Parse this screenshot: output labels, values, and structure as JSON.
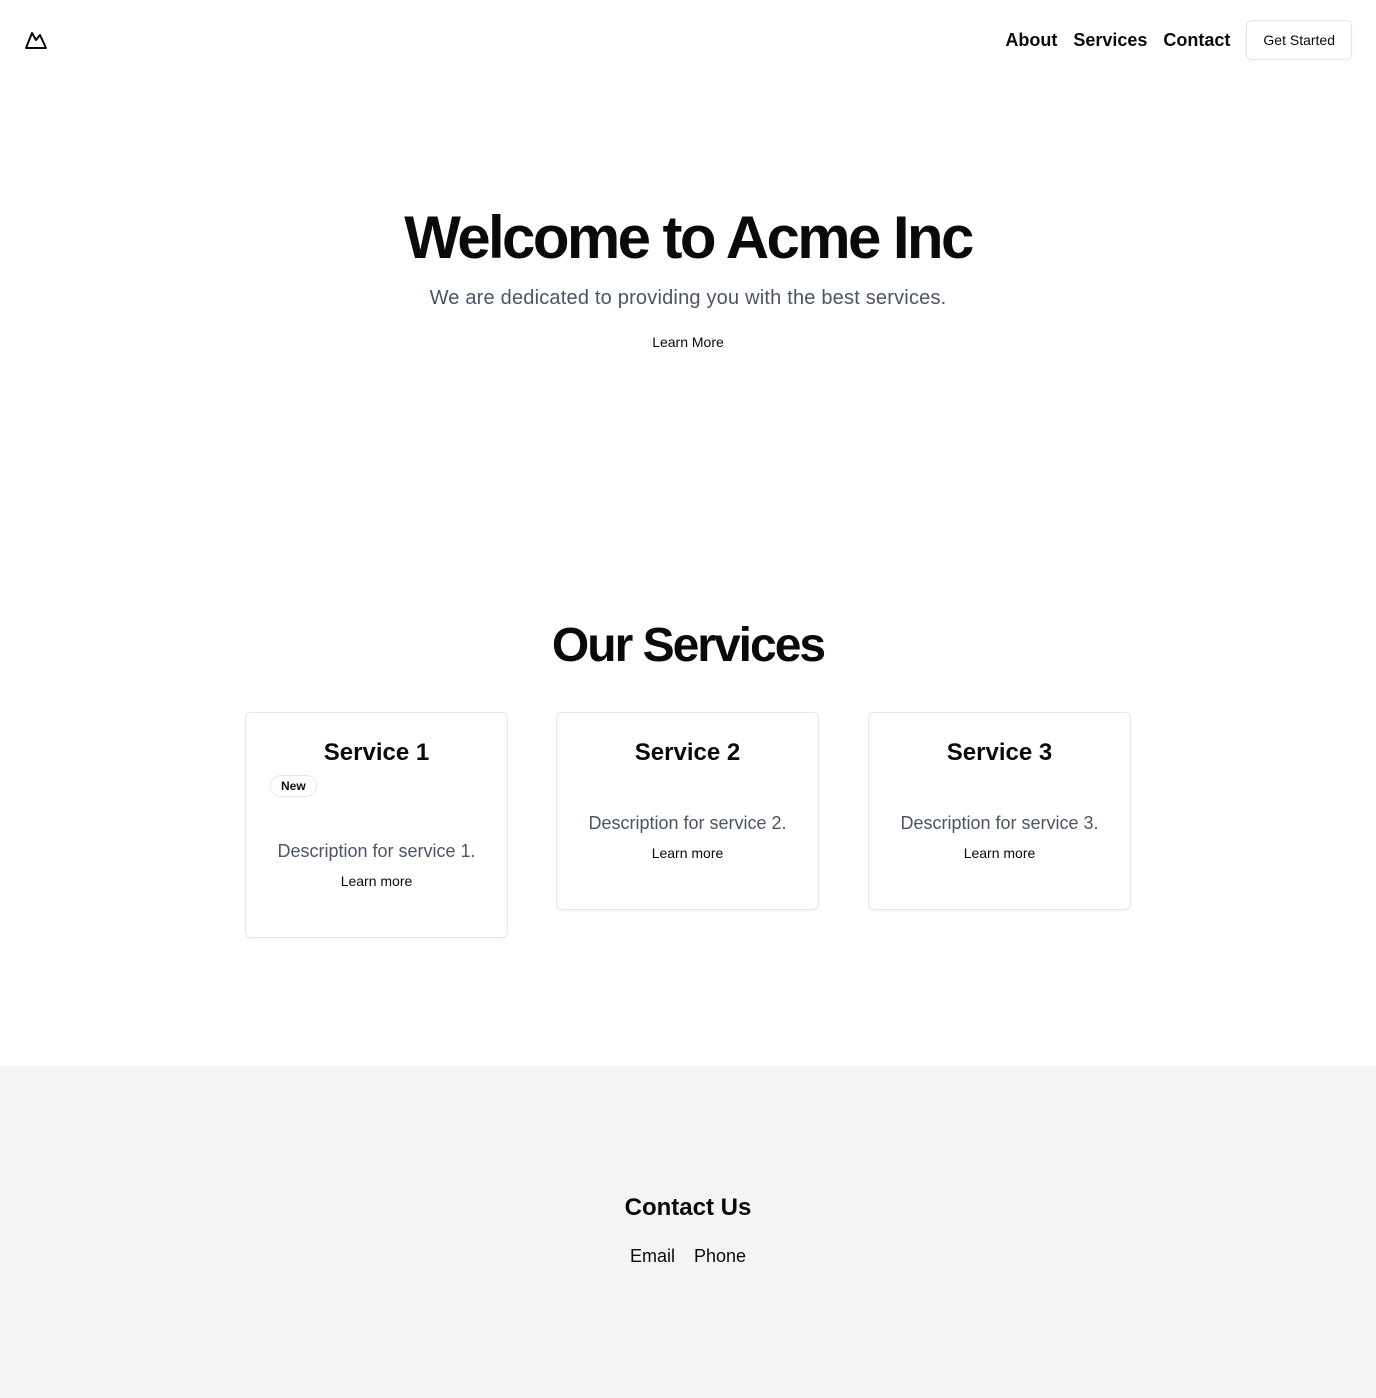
{
  "header": {
    "logo_icon": "mountain-icon",
    "nav": [
      "About",
      "Services",
      "Contact"
    ],
    "cta_label": "Get Started"
  },
  "hero": {
    "title": "Welcome to Acme Inc",
    "subtitle": "We are dedicated to providing you with the best services.",
    "button_label": "Learn More"
  },
  "services": {
    "title": "Our Services",
    "cards": [
      {
        "title": "Service 1",
        "badge": "New",
        "description": "Description for service 1.",
        "link": "Learn more"
      },
      {
        "title": "Service 2",
        "description": "Description for service 2.",
        "link": "Learn more"
      },
      {
        "title": "Service 3",
        "description": "Description for service 3.",
        "link": "Learn more"
      }
    ]
  },
  "contact": {
    "title": "Contact Us",
    "links": [
      "Email",
      "Phone"
    ]
  },
  "colors": {
    "text": "#0a0a0a",
    "muted_text": "#4b5563",
    "border": "#e5e7eb",
    "footer_bg": "#f3f4f6"
  }
}
